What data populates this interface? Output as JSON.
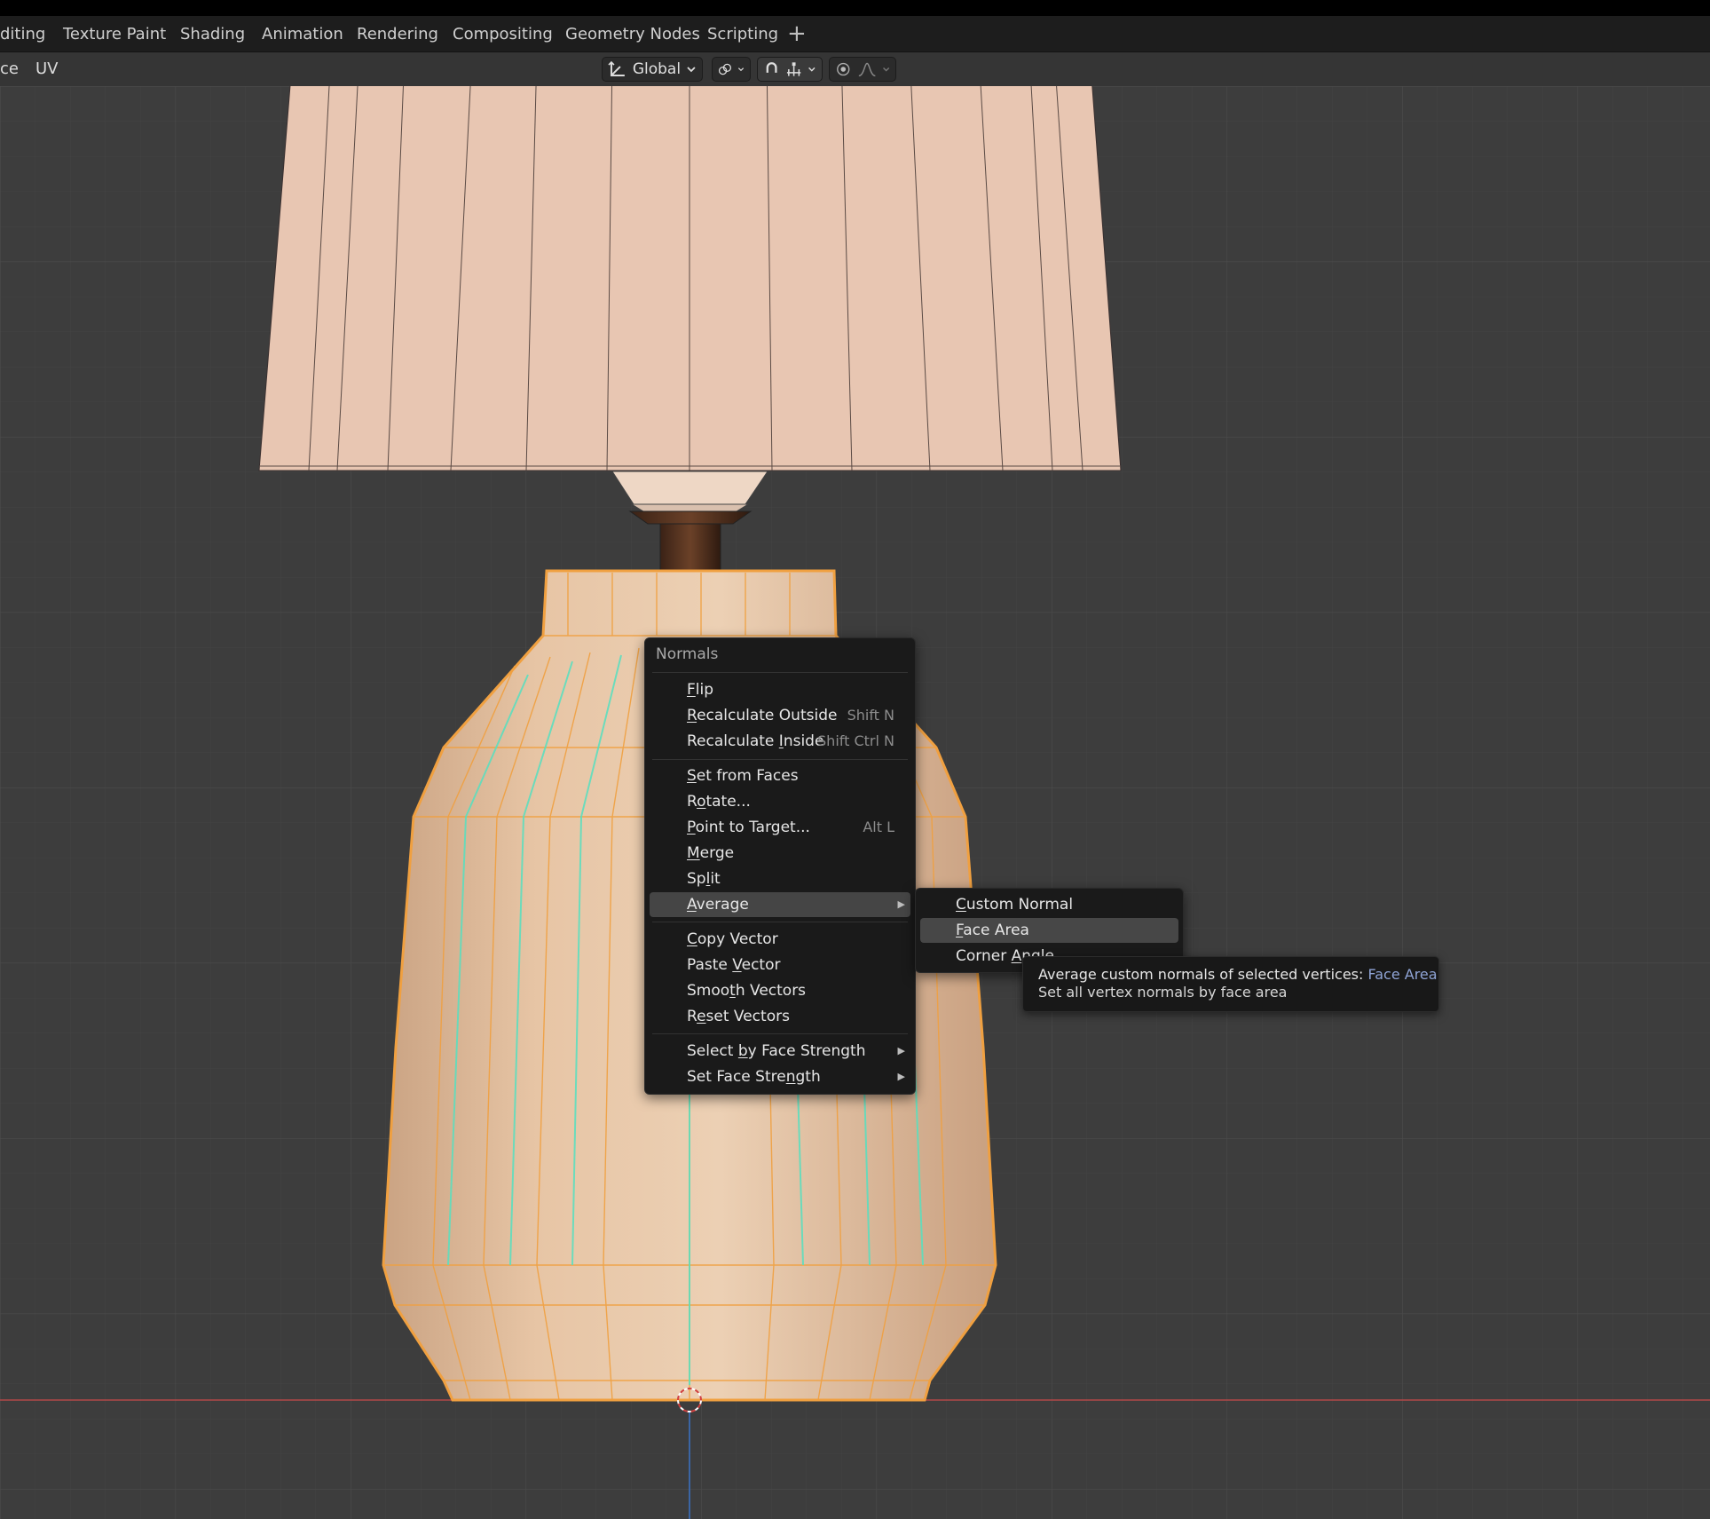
{
  "workspace_tabs": [
    "diting",
    "Texture Paint",
    "Shading",
    "Animation",
    "Rendering",
    "Compositing",
    "Geometry Nodes",
    "Scripting"
  ],
  "add_workspace_symbol": "+",
  "header": {
    "menus": [
      "ce",
      "UV"
    ],
    "orientation_label": "Global"
  },
  "context_menu": {
    "title": "Normals",
    "items": [
      {
        "pre": "",
        "key": "F",
        "post": "lip",
        "shortcut": ""
      },
      {
        "pre": "",
        "key": "R",
        "post": "ecalculate Outside",
        "shortcut": "Shift N"
      },
      {
        "pre": "Recalculate ",
        "key": "I",
        "post": "nside",
        "shortcut": "Shift Ctrl N"
      },
      {
        "pre": "",
        "key": "S",
        "post": "et from Faces",
        "shortcut": ""
      },
      {
        "pre": "R",
        "key": "o",
        "post": "tate...",
        "shortcut": ""
      },
      {
        "pre": "",
        "key": "P",
        "post": "oint to Target...",
        "shortcut": "Alt L"
      },
      {
        "pre": "",
        "key": "M",
        "post": "erge",
        "shortcut": ""
      },
      {
        "pre": "Sp",
        "key": "l",
        "post": "it",
        "shortcut": ""
      },
      {
        "pre": "",
        "key": "A",
        "post": "verage",
        "shortcut": "",
        "submenu": true
      },
      {
        "pre": "",
        "key": "C",
        "post": "opy Vector",
        "shortcut": ""
      },
      {
        "pre": "Paste ",
        "key": "V",
        "post": "ector",
        "shortcut": ""
      },
      {
        "pre": "Smoo",
        "key": "t",
        "post": "h Vectors",
        "shortcut": ""
      },
      {
        "pre": "R",
        "key": "e",
        "post": "set Vectors",
        "shortcut": ""
      },
      {
        "pre": "Select ",
        "key": "b",
        "post": "y Face Strength",
        "shortcut": "",
        "submenu": true
      },
      {
        "pre": "Set Face Stre",
        "key": "n",
        "post": "gth",
        "shortcut": "",
        "submenu": true
      }
    ]
  },
  "average_submenu": {
    "items": [
      {
        "pre": "",
        "key": "C",
        "post": "ustom Normal"
      },
      {
        "pre": "",
        "key": "F",
        "post": "ace Area"
      },
      {
        "pre": "Corner ",
        "key": "A",
        "post": "ngle"
      }
    ]
  },
  "tooltip": {
    "main": "Average custom normals of selected vertices: ",
    "accent": "Face Area",
    "description": "Set all vertex normals by face area"
  },
  "colors": {
    "viewport_bg": "#3d3d3d",
    "grid": "#464646",
    "menu_bg": "#1a1a1a",
    "highlight": "#454545",
    "selection_orange": "#f0a040",
    "normals_cyan": "#56e0c0",
    "shade_fill": "#e8c6b2",
    "x_axis": "#c44a4a",
    "z_axis": "#3b73c6"
  }
}
